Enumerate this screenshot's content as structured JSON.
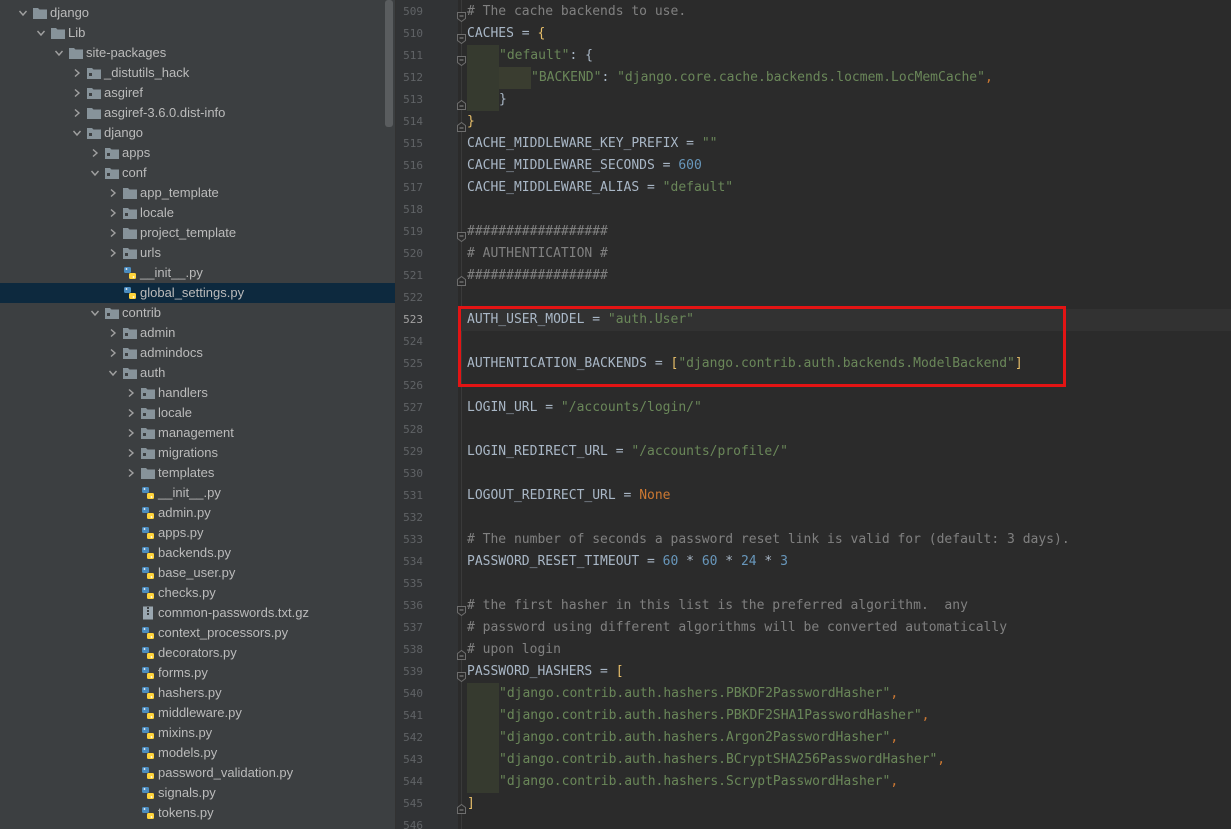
{
  "project_tree": {
    "rows": [
      {
        "depth": 2,
        "label": "django",
        "icon": "folder-icon",
        "expanded": true
      },
      {
        "depth": 3,
        "label": "Lib",
        "icon": "folder-icon",
        "expanded": true
      },
      {
        "depth": 4,
        "label": "site-packages",
        "icon": "folder-icon",
        "expanded": true
      },
      {
        "depth": 5,
        "label": "_distutils_hack",
        "icon": "package-folder-icon",
        "expanded": false
      },
      {
        "depth": 5,
        "label": "asgiref",
        "icon": "package-folder-icon",
        "expanded": false
      },
      {
        "depth": 5,
        "label": "asgiref-3.6.0.dist-info",
        "icon": "folder-icon",
        "expanded": false
      },
      {
        "depth": 5,
        "label": "django",
        "icon": "package-folder-icon",
        "expanded": true
      },
      {
        "depth": 6,
        "label": "apps",
        "icon": "package-folder-icon",
        "expanded": false
      },
      {
        "depth": 6,
        "label": "conf",
        "icon": "package-folder-icon",
        "expanded": true
      },
      {
        "depth": 7,
        "label": "app_template",
        "icon": "folder-icon",
        "expanded": false
      },
      {
        "depth": 7,
        "label": "locale",
        "icon": "package-folder-icon",
        "expanded": false
      },
      {
        "depth": 7,
        "label": "project_template",
        "icon": "folder-icon",
        "expanded": false
      },
      {
        "depth": 7,
        "label": "urls",
        "icon": "package-folder-icon",
        "expanded": false
      },
      {
        "depth": 7,
        "label": "__init__.py",
        "icon": "python-file-icon"
      },
      {
        "depth": 7,
        "label": "global_settings.py",
        "icon": "python-file-icon",
        "selected": true
      },
      {
        "depth": 6,
        "label": "contrib",
        "icon": "package-folder-icon",
        "expanded": true
      },
      {
        "depth": 7,
        "label": "admin",
        "icon": "package-folder-icon",
        "expanded": false
      },
      {
        "depth": 7,
        "label": "admindocs",
        "icon": "package-folder-icon",
        "expanded": false
      },
      {
        "depth": 7,
        "label": "auth",
        "icon": "package-folder-icon",
        "expanded": true
      },
      {
        "depth": 8,
        "label": "handlers",
        "icon": "package-folder-icon",
        "expanded": false
      },
      {
        "depth": 8,
        "label": "locale",
        "icon": "package-folder-icon",
        "expanded": false
      },
      {
        "depth": 8,
        "label": "management",
        "icon": "package-folder-icon",
        "expanded": false
      },
      {
        "depth": 8,
        "label": "migrations",
        "icon": "package-folder-icon",
        "expanded": false
      },
      {
        "depth": 8,
        "label": "templates",
        "icon": "folder-icon",
        "expanded": false
      },
      {
        "depth": 8,
        "label": "__init__.py",
        "icon": "python-file-icon"
      },
      {
        "depth": 8,
        "label": "admin.py",
        "icon": "python-file-icon"
      },
      {
        "depth": 8,
        "label": "apps.py",
        "icon": "python-file-icon"
      },
      {
        "depth": 8,
        "label": "backends.py",
        "icon": "python-file-icon"
      },
      {
        "depth": 8,
        "label": "base_user.py",
        "icon": "python-file-icon"
      },
      {
        "depth": 8,
        "label": "checks.py",
        "icon": "python-file-icon"
      },
      {
        "depth": 8,
        "label": "common-passwords.txt.gz",
        "icon": "archive-file-icon"
      },
      {
        "depth": 8,
        "label": "context_processors.py",
        "icon": "python-file-icon"
      },
      {
        "depth": 8,
        "label": "decorators.py",
        "icon": "python-file-icon"
      },
      {
        "depth": 8,
        "label": "forms.py",
        "icon": "python-file-icon"
      },
      {
        "depth": 8,
        "label": "hashers.py",
        "icon": "python-file-icon"
      },
      {
        "depth": 8,
        "label": "middleware.py",
        "icon": "python-file-icon"
      },
      {
        "depth": 8,
        "label": "mixins.py",
        "icon": "python-file-icon"
      },
      {
        "depth": 8,
        "label": "models.py",
        "icon": "python-file-icon"
      },
      {
        "depth": 8,
        "label": "password_validation.py",
        "icon": "python-file-icon"
      },
      {
        "depth": 8,
        "label": "signals.py",
        "icon": "python-file-icon"
      },
      {
        "depth": 8,
        "label": "tokens.py",
        "icon": "python-file-icon"
      }
    ]
  },
  "editor": {
    "current_line": 523,
    "lines": [
      {
        "n": "509",
        "fold": "start",
        "tokens": [
          [
            "com",
            "# The cache backends to use."
          ]
        ]
      },
      {
        "n": "510",
        "fold": "start",
        "tokens": [
          [
            "plain",
            "CACHES = "
          ],
          [
            "br",
            "{"
          ]
        ]
      },
      {
        "n": "511",
        "fold": "start",
        "indent": 1,
        "tokens": [
          [
            "str",
            "\"default\""
          ],
          [
            "plain",
            ": {"
          ]
        ]
      },
      {
        "n": "512",
        "indent": 2,
        "tokens": [
          [
            "str",
            "\"BACKEND\""
          ],
          [
            "plain",
            ": "
          ],
          [
            "str",
            "\"django.core.cache.backends.locmem.LocMemCache\""
          ],
          [
            "kw",
            ","
          ]
        ]
      },
      {
        "n": "513",
        "fold": "end",
        "indent": 1,
        "tokens": [
          [
            "plain",
            "}"
          ]
        ]
      },
      {
        "n": "514",
        "fold": "end",
        "tokens": [
          [
            "br",
            "}"
          ]
        ]
      },
      {
        "n": "515",
        "tokens": [
          [
            "plain",
            "CACHE_MIDDLEWARE_KEY_PREFIX = "
          ],
          [
            "str",
            "\"\""
          ]
        ]
      },
      {
        "n": "516",
        "tokens": [
          [
            "plain",
            "CACHE_MIDDLEWARE_SECONDS = "
          ],
          [
            "num",
            "600"
          ]
        ]
      },
      {
        "n": "517",
        "tokens": [
          [
            "plain",
            "CACHE_MIDDLEWARE_ALIAS = "
          ],
          [
            "str",
            "\"default\""
          ]
        ]
      },
      {
        "n": "518",
        "tokens": []
      },
      {
        "n": "519",
        "fold": "start",
        "tokens": [
          [
            "com",
            "##################"
          ]
        ]
      },
      {
        "n": "520",
        "tokens": [
          [
            "com",
            "# AUTHENTICATION #"
          ]
        ]
      },
      {
        "n": "521",
        "fold": "end",
        "tokens": [
          [
            "com",
            "##################"
          ]
        ]
      },
      {
        "n": "522",
        "tokens": []
      },
      {
        "n": "523",
        "tokens": [
          [
            "plain",
            "AUTH_USER_MODEL = "
          ],
          [
            "str",
            "\"auth.User\""
          ]
        ]
      },
      {
        "n": "524",
        "tokens": []
      },
      {
        "n": "525",
        "tokens": [
          [
            "plain",
            "AUTHENTICATION_BACKENDS = "
          ],
          [
            "br",
            "["
          ],
          [
            "str",
            "\"django.contrib.auth.backends.ModelBackend\""
          ],
          [
            "br",
            "]"
          ]
        ]
      },
      {
        "n": "526",
        "tokens": []
      },
      {
        "n": "527",
        "tokens": [
          [
            "plain",
            "LOGIN_URL = "
          ],
          [
            "str",
            "\"/accounts/login/\""
          ]
        ]
      },
      {
        "n": "528",
        "tokens": []
      },
      {
        "n": "529",
        "tokens": [
          [
            "plain",
            "LOGIN_REDIRECT_URL = "
          ],
          [
            "str",
            "\"/accounts/profile/\""
          ]
        ]
      },
      {
        "n": "530",
        "tokens": []
      },
      {
        "n": "531",
        "tokens": [
          [
            "plain",
            "LOGOUT_REDIRECT_URL = "
          ],
          [
            "kw",
            "None"
          ]
        ]
      },
      {
        "n": "532",
        "tokens": []
      },
      {
        "n": "533",
        "tokens": [
          [
            "com",
            "# The number of seconds a password reset link is valid for (default: 3 days)."
          ]
        ]
      },
      {
        "n": "534",
        "tokens": [
          [
            "plain",
            "PASSWORD_RESET_TIMEOUT = "
          ],
          [
            "num",
            "60"
          ],
          [
            "plain",
            " * "
          ],
          [
            "num",
            "60"
          ],
          [
            "plain",
            " * "
          ],
          [
            "num",
            "24"
          ],
          [
            "plain",
            " * "
          ],
          [
            "num",
            "3"
          ]
        ]
      },
      {
        "n": "535",
        "tokens": []
      },
      {
        "n": "536",
        "fold": "start",
        "tokens": [
          [
            "com",
            "# the first hasher in this list is the preferred algorithm.  any"
          ]
        ]
      },
      {
        "n": "537",
        "tokens": [
          [
            "com",
            "# password using different algorithms will be converted automatically"
          ]
        ]
      },
      {
        "n": "538",
        "fold": "end",
        "tokens": [
          [
            "com",
            "# upon login"
          ]
        ]
      },
      {
        "n": "539",
        "fold": "start",
        "tokens": [
          [
            "plain",
            "PASSWORD_HASHERS = "
          ],
          [
            "br",
            "["
          ]
        ]
      },
      {
        "n": "540",
        "indent": 1,
        "tokens": [
          [
            "str",
            "\"django.contrib.auth.hashers.PBKDF2PasswordHasher\""
          ],
          [
            "kw",
            ","
          ]
        ]
      },
      {
        "n": "541",
        "indent": 1,
        "tokens": [
          [
            "str",
            "\"django.contrib.auth.hashers.PBKDF2SHA1PasswordHasher\""
          ],
          [
            "kw",
            ","
          ]
        ]
      },
      {
        "n": "542",
        "indent": 1,
        "tokens": [
          [
            "str",
            "\"django.contrib.auth.hashers.Argon2PasswordHasher\""
          ],
          [
            "kw",
            ","
          ]
        ]
      },
      {
        "n": "543",
        "indent": 1,
        "tokens": [
          [
            "str",
            "\"django.contrib.auth.hashers.BCryptSHA256PasswordHasher\""
          ],
          [
            "kw",
            ","
          ]
        ]
      },
      {
        "n": "544",
        "indent": 1,
        "tokens": [
          [
            "str",
            "\"django.contrib.auth.hashers.ScryptPasswordHasher\""
          ],
          [
            "kw",
            ","
          ]
        ]
      },
      {
        "n": "545",
        "fold": "end",
        "tokens": [
          [
            "br",
            "]"
          ]
        ]
      },
      {
        "n": "546",
        "tokens": []
      }
    ]
  },
  "colors": {
    "highlight_box": "#e31414",
    "selected_row": "#0d293e",
    "string": "#6a8759",
    "number": "#6897bb",
    "keyword": "#cc7832",
    "comment": "#808080"
  }
}
